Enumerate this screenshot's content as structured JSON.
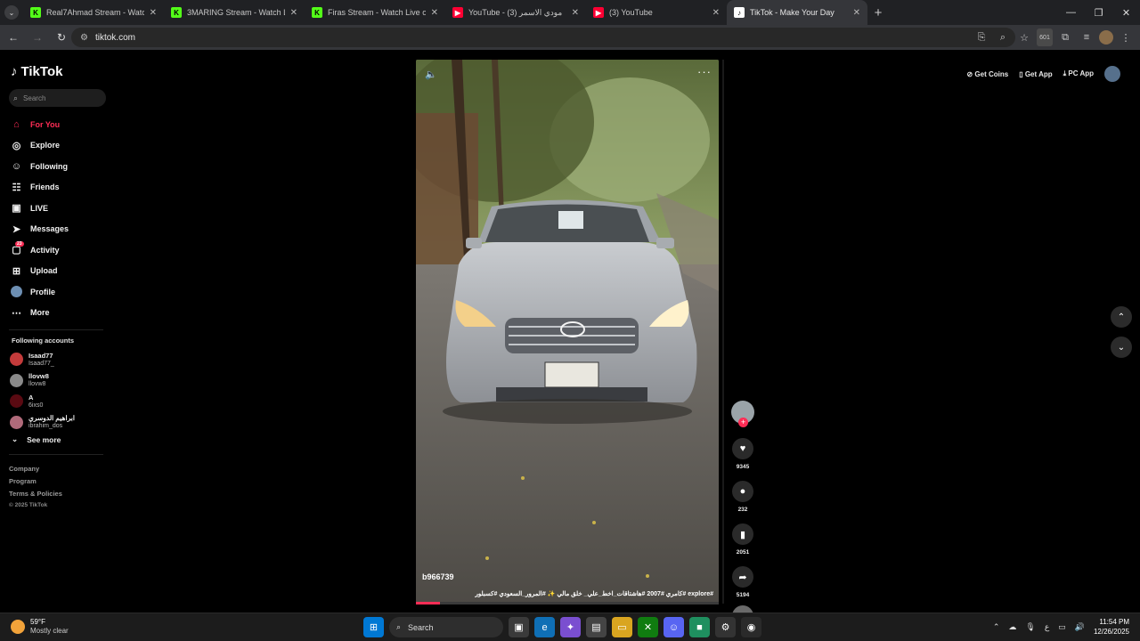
{
  "browser": {
    "tabs": [
      {
        "title": "Real7Ahmad Stream - Watch Li",
        "favicon": "kick-icon",
        "color": "#53fc18"
      },
      {
        "title": "3MARING Stream - Watch Live",
        "favicon": "kick-icon",
        "color": "#53fc18"
      },
      {
        "title": "Firas Stream - Watch Live on Ki",
        "favicon": "kick-icon",
        "color": "#53fc18"
      },
      {
        "title": "YouTube - (3) مودي الاسمر",
        "favicon": "youtube-icon",
        "color": "#ff0033"
      },
      {
        "title": "(3) YouTube",
        "favicon": "youtube-icon",
        "color": "#ff0033"
      },
      {
        "title": "TikTok - Make Your Day",
        "favicon": "tiktok-icon",
        "color": "#ffffff"
      }
    ],
    "url": "tiktok.com",
    "extension_badge": "601"
  },
  "tiktok": {
    "logo_text": "TikTok",
    "search_placeholder": "Search",
    "nav": [
      {
        "label": "For You",
        "icon": "home-icon"
      },
      {
        "label": "Explore",
        "icon": "compass-icon"
      },
      {
        "label": "Following",
        "icon": "following-icon"
      },
      {
        "label": "Friends",
        "icon": "friends-icon"
      },
      {
        "label": "LIVE",
        "icon": "live-icon"
      },
      {
        "label": "Messages",
        "icon": "messages-icon"
      },
      {
        "label": "Activity",
        "icon": "activity-icon",
        "badge": "23"
      },
      {
        "label": "Upload",
        "icon": "upload-icon"
      },
      {
        "label": "Profile",
        "icon": "avatar"
      },
      {
        "label": "More",
        "icon": "more-icon"
      }
    ],
    "following_title": "Following accounts",
    "accounts": [
      {
        "name": "Isaad77",
        "handle": "Isaad77_",
        "color": "#c43b3b"
      },
      {
        "name": "llovw8",
        "handle": "llovw8",
        "color": "#8a8a8a"
      },
      {
        "name": "A",
        "handle": "6ixs0",
        "color": "#5a0a12"
      },
      {
        "name": "ابراهيم الدوسري",
        "handle": "ibrahim_dos",
        "color": "#b06a7a"
      }
    ],
    "see_more": "See more",
    "footer": [
      "Company",
      "Program",
      "Terms & Policies"
    ],
    "copyright": "© 2025 TikTok",
    "header": {
      "get_coins": "Get Coins",
      "get_app": "Get App",
      "pc_app": "PC App"
    },
    "video": {
      "username": "b966739",
      "caption": "#explore #كامري #2007 #هاشتاقات_اخط_علي_ خلق ماليٍ ✨ #المرور_السعودي #كسبلور",
      "progress": 0.08
    },
    "actions": {
      "likes": "9345",
      "comments": "232",
      "saves": "2051",
      "shares": "5194"
    }
  },
  "taskbar": {
    "temp": "59°F",
    "weather": "Mostly clear",
    "search_label": "Search",
    "time": "11:54 PM",
    "date": "12/26/2025"
  }
}
